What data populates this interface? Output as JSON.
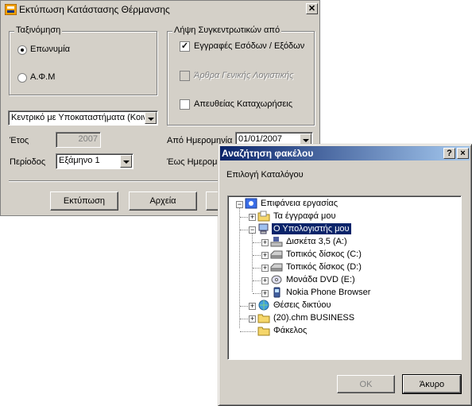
{
  "main_dialog": {
    "title": "Εκτύπωση Κατάστασης Θέρμανσης",
    "sort_group": {
      "label": "Ταξινόμηση",
      "options": [
        {
          "label": "Επωνυμία",
          "selected": true
        },
        {
          "label": "Α.Φ.Μ",
          "selected": false
        }
      ]
    },
    "totals_group": {
      "label": "Λήψη Συγκεντρωτικών από",
      "options": [
        {
          "label": "Εγγραφές Εσόδων / Εξόδων",
          "checked": true,
          "enabled": true
        },
        {
          "label": "Άρθρα Γενικής Λογιστικής",
          "checked": false,
          "enabled": false
        },
        {
          "label": "Απευθείας Καταχωρήσεις",
          "checked": false,
          "enabled": true
        }
      ]
    },
    "branch_select": "Κεντρικό με Υποκαταστήματα (Κοιν",
    "year_label": "Έτος",
    "year_value": "2007",
    "period_label": "Περίοδος",
    "period_value": "Εξάμηνο 1",
    "from_date_label": "Από Ημερομηνία",
    "from_date_value": "01/01/2007",
    "to_date_label": "Έως Ημερομ",
    "buttons": {
      "print": "Εκτύπωση",
      "files": "Αρχεία"
    }
  },
  "browse_dialog": {
    "title": "Αναζήτηση φακέλου",
    "prompt": "Επιλογή Καταλόγου",
    "tree": [
      {
        "label": "Επιφάνεια εργασίας",
        "icon": "desktop-icon"
      },
      {
        "label": "Τα έγγραφά μου",
        "icon": "folder-icon"
      },
      {
        "label": "Ο Υπολογιστής μου",
        "icon": "computer-icon",
        "selected": true
      },
      {
        "label": "Δισκέτα 3,5 (A:)",
        "icon": "floppy-icon"
      },
      {
        "label": "Τοπικός δίσκος (C:)",
        "icon": "drive-icon"
      },
      {
        "label": "Τοπικός δίσκος (D:)",
        "icon": "drive-icon"
      },
      {
        "label": "Μονάδα DVD (E:)",
        "icon": "dvd-icon"
      },
      {
        "label": "Nokia Phone Browser",
        "icon": "phone-icon"
      },
      {
        "label": "Θέσεις δικτύου",
        "icon": "network-icon"
      },
      {
        "label": "(20).chm BUSINESS",
        "icon": "folder-icon"
      },
      {
        "label": "Φάκελος",
        "icon": "folder-icon"
      }
    ],
    "buttons": {
      "ok": "OK",
      "cancel": "Άκυρο"
    },
    "help_glyph": "?",
    "close_glyph": "×"
  },
  "colors": {
    "active_title": "#0a246a",
    "face": "#d4d0c8",
    "selection": "#0a246a"
  }
}
